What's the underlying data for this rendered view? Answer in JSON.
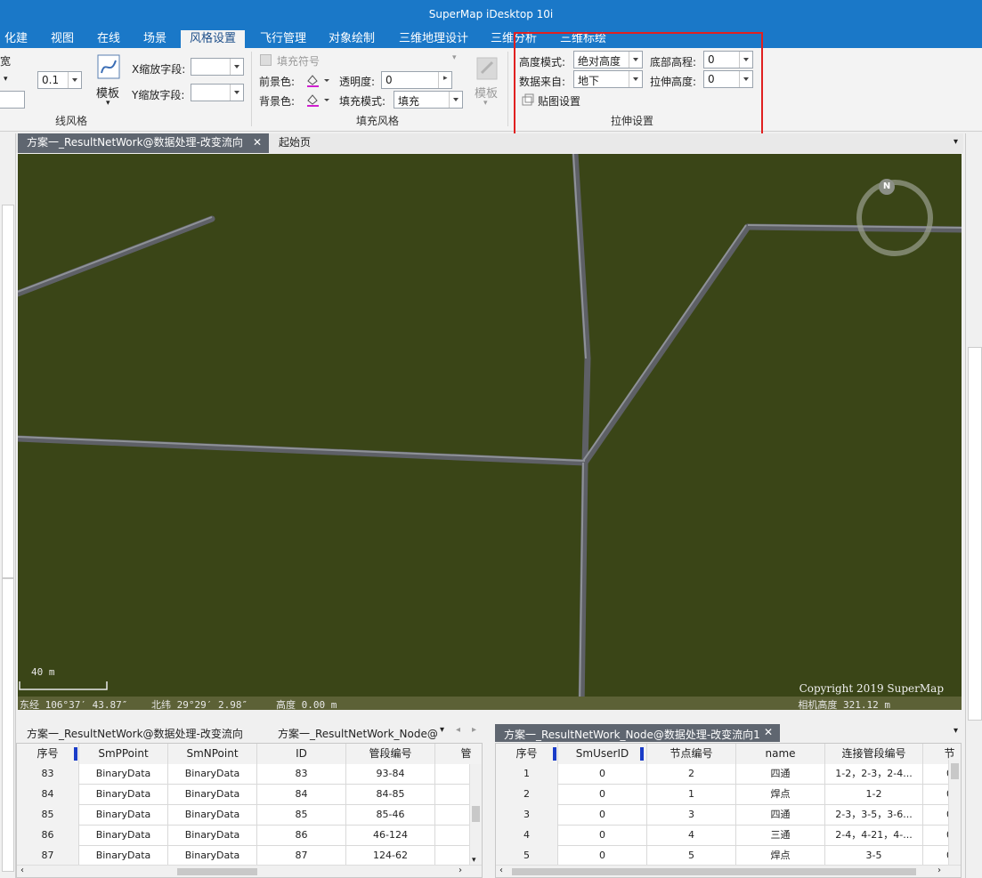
{
  "window": {
    "title": "SuperMap iDesktop 10i"
  },
  "ribbon_tabs": [
    "化建模",
    "视图",
    "在线",
    "场景",
    "风格设置",
    "飞行管理",
    "对象绘制",
    "三维地理设计",
    "三维分析",
    "三维标绘"
  ],
  "ribbon_active_tab": "风格设置",
  "line_style": {
    "left_cut_label": "宽",
    "width_value": "0.1",
    "template_label": "模板",
    "x_scale_label": "X缩放字段:",
    "y_scale_label": "Y缩放字段:",
    "caption": "线风格"
  },
  "fill_style": {
    "fill_symbol_label": "填充符号",
    "fore_color_label": "前景色:",
    "back_color_label": "背景色:",
    "transparency_label": "透明度:",
    "transparency_value": "0",
    "fill_mode_label": "填充模式:",
    "fill_mode_value": "填充",
    "template_label": "模板",
    "caption": "填充风格",
    "accent_color": "#d020d0"
  },
  "extrude": {
    "height_mode_label": "高度模式:",
    "height_mode_value": "绝对高度",
    "bottom_alt_label": "底部高程:",
    "bottom_alt_value": "0",
    "data_source_label": "数据来自:",
    "data_source_value": "地下",
    "extrude_height_label": "拉伸高度:",
    "extrude_height_value": "0",
    "texture_label": "贴图设置",
    "caption": "拉伸设置",
    "highlight_color": "#e02020"
  },
  "doc_tabs": [
    "方案一_ResultNetWork@数据处理-改变流向",
    "起始页"
  ],
  "scene": {
    "scale_label": "40 m",
    "copyright": "Copyright 2019 SuperMap",
    "lon_label": "东经 106°37′ 43.87″",
    "lat_label": "北纬 29°29′ 2.98″",
    "alt_label": "高度 0.00 m",
    "cam_label": "相机高度 321.12 m",
    "compass_letter": "N",
    "ground_color": "#3a4517"
  },
  "left_table": {
    "tabs": [
      "方案一_ResultNetWork@数据处理-改变流向",
      "方案一_ResultNetWork_Node@数"
    ],
    "columns": [
      "序号",
      "SmPPoint",
      "SmNPoint",
      "ID",
      "管段编号",
      "管"
    ],
    "rows": [
      [
        "83",
        "BinaryData",
        "BinaryData",
        "83",
        "93-84",
        ""
      ],
      [
        "84",
        "BinaryData",
        "BinaryData",
        "84",
        "84-85",
        ""
      ],
      [
        "85",
        "BinaryData",
        "BinaryData",
        "85",
        "85-46",
        ""
      ],
      [
        "86",
        "BinaryData",
        "BinaryData",
        "86",
        "46-124",
        ""
      ],
      [
        "87",
        "BinaryData",
        "BinaryData",
        "87",
        "124-62",
        ""
      ]
    ]
  },
  "right_table": {
    "tab": "方案一_ResultNetWork_Node@数据处理-改变流向1",
    "columns": [
      "序号",
      "SmUserID",
      "节点编号",
      "name",
      "连接管段编号",
      "节"
    ],
    "rows": [
      [
        "1",
        "0",
        "2",
        "四通",
        "1-2，2-3，2-4...",
        "0"
      ],
      [
        "2",
        "0",
        "1",
        "焊点",
        "1-2",
        "0"
      ],
      [
        "3",
        "0",
        "3",
        "四通",
        "2-3，3-5，3-6...",
        "0"
      ],
      [
        "4",
        "0",
        "4",
        "三通",
        "2-4，4-21，4-...",
        "0"
      ],
      [
        "5",
        "0",
        "5",
        "焊点",
        "3-5",
        "0"
      ]
    ]
  }
}
